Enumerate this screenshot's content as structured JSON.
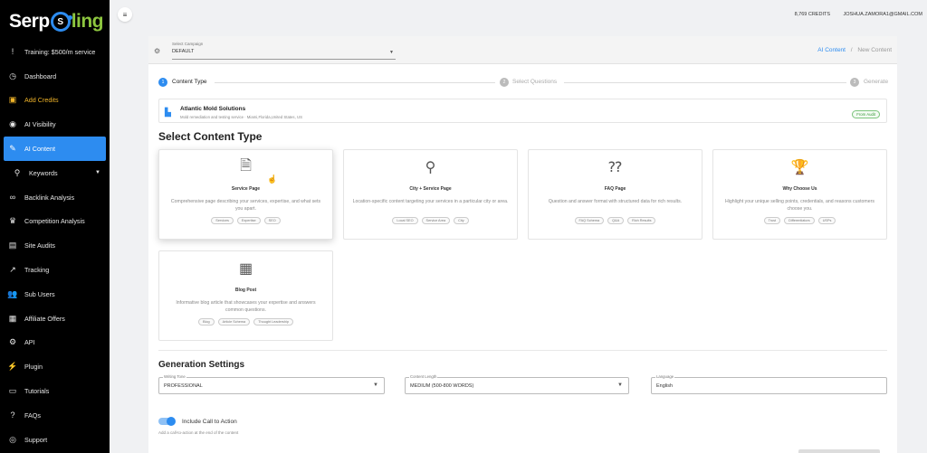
{
  "brand": {
    "part1": "Serp",
    "ring": "S",
    "part2": "ling"
  },
  "sidebar": {
    "items": [
      {
        "label": "Training: $500/m service",
        "icon": "!"
      },
      {
        "label": "Dashboard",
        "icon": "◷"
      },
      {
        "label": "Add Credits",
        "icon": "▣"
      },
      {
        "label": "AI Visibility",
        "icon": "◉"
      },
      {
        "label": "AI Content",
        "icon": "✎"
      },
      {
        "label": "Keywords",
        "icon": "⚲"
      },
      {
        "label": "Backlink Analysis",
        "icon": "∞"
      },
      {
        "label": "Competition Analysis",
        "icon": "♛"
      },
      {
        "label": "Site Audits",
        "icon": "▤"
      },
      {
        "label": "Tracking",
        "icon": "↗"
      },
      {
        "label": "Sub Users",
        "icon": "👥"
      },
      {
        "label": "Affiliate Offers",
        "icon": "▦"
      },
      {
        "label": "API",
        "icon": "⚙"
      },
      {
        "label": "Plugin",
        "icon": "⚡"
      },
      {
        "label": "Tutorials",
        "icon": "▭"
      },
      {
        "label": "FAQs",
        "icon": "?"
      },
      {
        "label": "Support",
        "icon": "◎"
      }
    ]
  },
  "topbar": {
    "menu_icon": "≡",
    "credits": "8,769 CREDITS",
    "email": "JOSHUA.ZAMORA1@GMAIL.COM"
  },
  "campaign": {
    "label": "Select Campaign",
    "value": "DEFAULT"
  },
  "breadcrumb": {
    "link": "AI Content",
    "sep": "/",
    "current": "New Content"
  },
  "steps": [
    {
      "num": "1",
      "label": "Content Type"
    },
    {
      "num": "2",
      "label": "Select Questions"
    },
    {
      "num": "3",
      "label": "Generate"
    }
  ],
  "business": {
    "name": "Atlantic Mold Solutions",
    "desc": "Mold remediation and testing service · Miami,Florida,United States, US",
    "badge": "From Audit"
  },
  "section_title": "Select Content Type",
  "cards": [
    {
      "title": "Service Page",
      "icon": "🗎",
      "desc": "Comprehensive page describing your services, expertise, and what sets you apart.",
      "tags": [
        "Services",
        "Expertise",
        "SEO"
      ]
    },
    {
      "title": "City + Service Page",
      "icon": "⚲",
      "desc": "Location-specific content targeting your services in a particular city or area.",
      "tags": [
        "Local SEO",
        "Service Area",
        "City"
      ]
    },
    {
      "title": "FAQ Page",
      "icon": "⁇",
      "desc": "Question and answer format with structured data for rich results.",
      "tags": [
        "FAQ Schema",
        "Q&A",
        "Rich Results"
      ]
    },
    {
      "title": "Why Choose Us",
      "icon": "🏆",
      "desc": "Highlight your unique selling points, credentials, and reasons customers choose you.",
      "tags": [
        "Trust",
        "Differentiators",
        "USPs"
      ]
    },
    {
      "title": "Blog Post",
      "icon": "▦",
      "desc": "Informative blog article that showcases your expertise and answers common questions.",
      "tags": [
        "Blog",
        "Article Schema",
        "Thought Leadership"
      ]
    }
  ],
  "generation": {
    "title": "Generation Settings",
    "tone": {
      "label": "Writing Tone",
      "value": "PROFESSIONAL"
    },
    "length": {
      "label": "Content Length",
      "value": "MEDIUM (500-800 WORDS)"
    },
    "language": {
      "label": "Language",
      "value": "English"
    },
    "cta_label": "Include Call to Action",
    "cta_help": "Add a call-to-action at the end of the content",
    "cta_enabled": true
  }
}
